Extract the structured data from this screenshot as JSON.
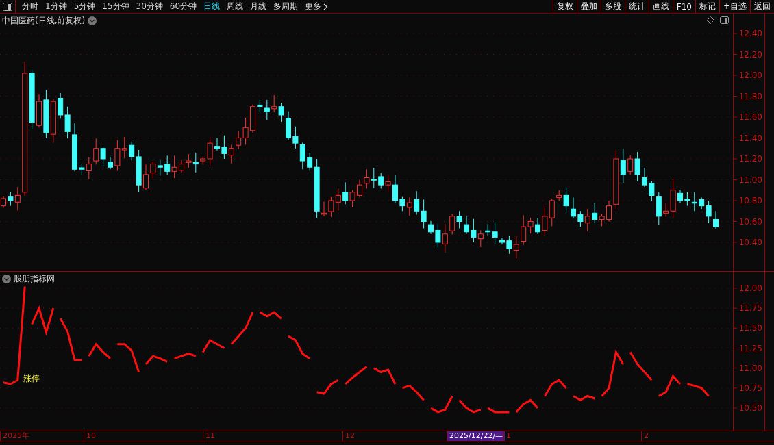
{
  "toolbar": {
    "periods": [
      {
        "label": "分时",
        "selected": false
      },
      {
        "label": "1分钟",
        "selected": false
      },
      {
        "label": "5分钟",
        "selected": false
      },
      {
        "label": "15分钟",
        "selected": false
      },
      {
        "label": "30分钟",
        "selected": false
      },
      {
        "label": "60分钟",
        "selected": false
      },
      {
        "label": "日线",
        "selected": true
      },
      {
        "label": "周线",
        "selected": false
      },
      {
        "label": "月线",
        "selected": false
      },
      {
        "label": "多周期",
        "selected": false
      },
      {
        "label": "更多",
        "selected": false
      }
    ],
    "actions": [
      "复权",
      "叠加",
      "多股",
      "统计",
      "画线",
      "F10",
      "标记",
      "+自选",
      "返回"
    ]
  },
  "main_chart": {
    "title": "中国医药(日线,前复权)",
    "price_ticks": [
      "12.40",
      "12.20",
      "12.00",
      "11.80",
      "11.60",
      "11.40",
      "11.20",
      "11.00",
      "10.80",
      "10.60",
      "10.40"
    ]
  },
  "indicator": {
    "title": "股朋指标网",
    "signal_label": "涨停",
    "ticks": [
      "12.00",
      "11.75",
      "11.50",
      "11.25",
      "11.00",
      "10.75",
      "10.50"
    ]
  },
  "time_axis": [
    {
      "label": "2025年",
      "selected": false
    },
    {
      "label": "10",
      "selected": false
    },
    {
      "label": "11",
      "selected": false
    },
    {
      "label": "12",
      "selected": false
    },
    {
      "label": "2025/12/22/—",
      "selected": true
    },
    {
      "label": "1",
      "selected": false
    },
    {
      "label": "2",
      "selected": false
    }
  ]
}
